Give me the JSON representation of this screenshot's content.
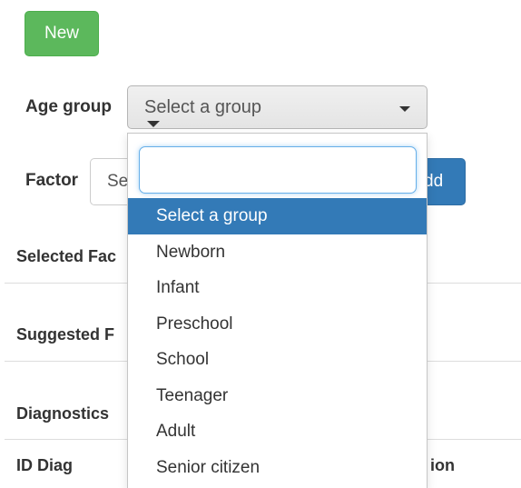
{
  "new_button": "New",
  "age_group": {
    "label": "Age group",
    "selected": "Select a group"
  },
  "factor": {
    "label": "Factor",
    "input_value": "Se",
    "add_button_visible_text": "dd"
  },
  "sections": {
    "selected_factors": "Selected Fac",
    "suggested": "Suggested F",
    "diagnostics": "Diagnostics"
  },
  "table": {
    "col_id_diag": "ID Diag",
    "col_right_partial": "ion"
  },
  "dropdown": {
    "search_value": "",
    "options": [
      {
        "label": "Select a group",
        "active": true
      },
      {
        "label": "Newborn",
        "active": false
      },
      {
        "label": "Infant",
        "active": false
      },
      {
        "label": "Preschool",
        "active": false
      },
      {
        "label": "School",
        "active": false
      },
      {
        "label": "Teenager",
        "active": false
      },
      {
        "label": "Adult",
        "active": false
      },
      {
        "label": "Senior citizen",
        "active": false
      }
    ]
  },
  "colors": {
    "new_button": "#5cb85c",
    "add_button": "#337ab7",
    "highlight": "#337ab7"
  }
}
